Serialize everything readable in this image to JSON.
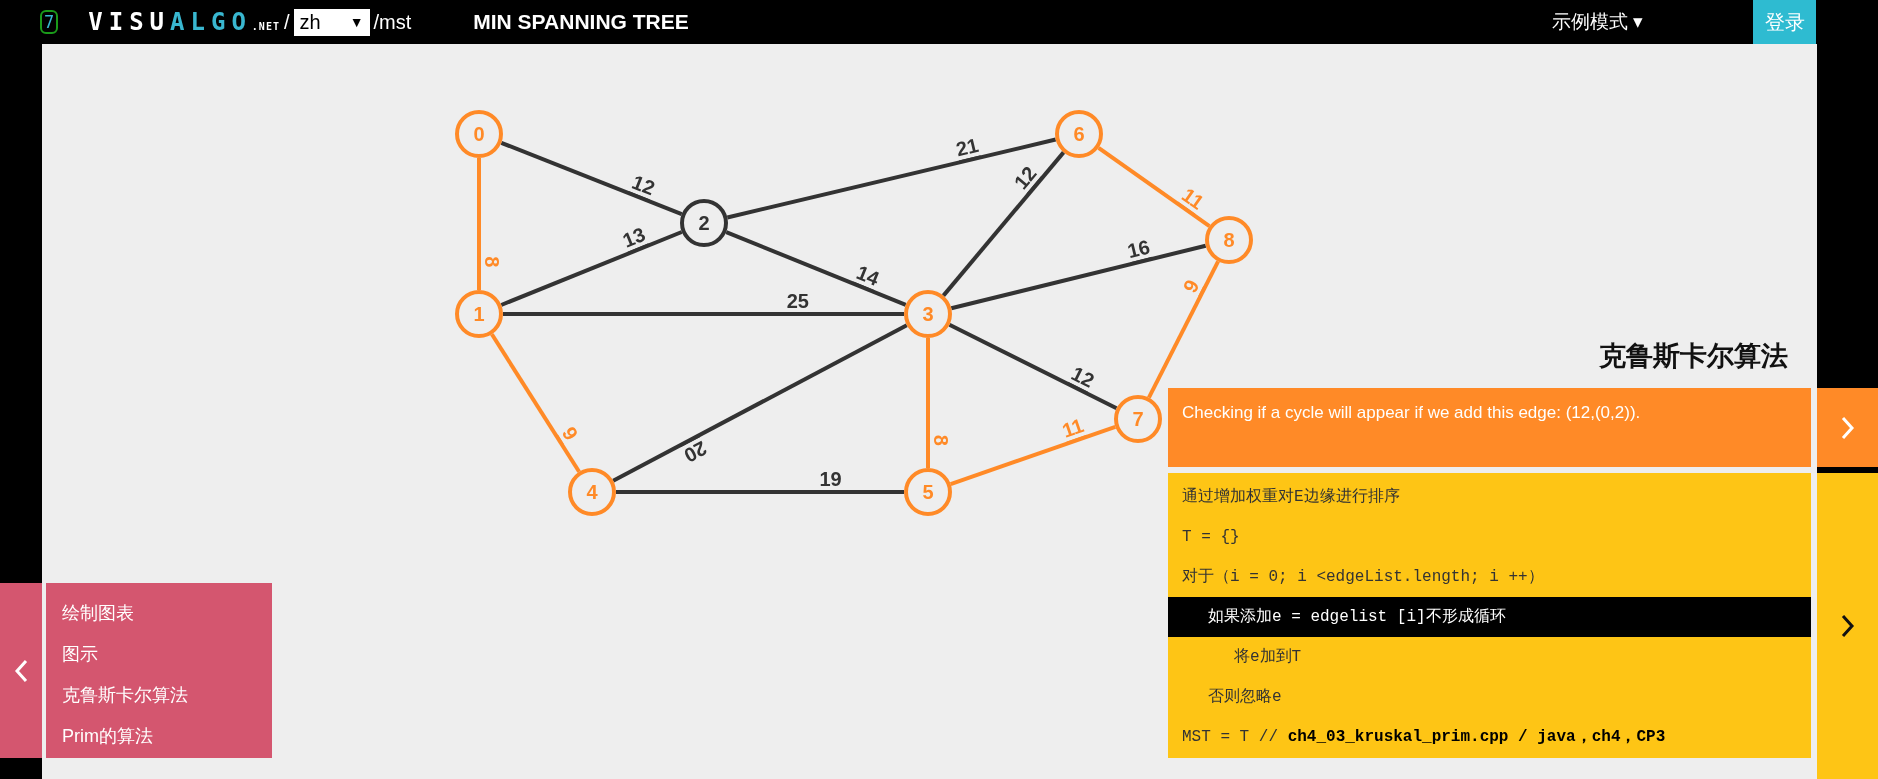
{
  "header": {
    "badge": "7",
    "logo": {
      "text_1": "VISU",
      "text_2": "ALGO",
      "suffix": ".NET"
    },
    "separator": "/",
    "language": {
      "value": "zh",
      "arrow": "▼"
    },
    "path": "/mst",
    "title": "MIN SPANNING TREE",
    "mode_menu": {
      "label": "示例模式",
      "caret": "▾"
    },
    "login": "登录"
  },
  "graph": {
    "nodes": [
      {
        "label": "0",
        "highlighted": true
      },
      {
        "label": "1",
        "highlighted": true
      },
      {
        "label": "2",
        "highlighted": false
      },
      {
        "label": "3",
        "highlighted": true
      },
      {
        "label": "4",
        "highlighted": true
      },
      {
        "label": "5",
        "highlighted": true
      },
      {
        "label": "6",
        "highlighted": true
      },
      {
        "label": "7",
        "highlighted": true
      },
      {
        "label": "8",
        "highlighted": true
      }
    ],
    "edges": [
      {
        "weight": "12",
        "highlighted": false
      },
      {
        "weight": "8",
        "highlighted": true
      },
      {
        "weight": "21",
        "highlighted": false
      },
      {
        "weight": "13",
        "highlighted": false
      },
      {
        "weight": "14",
        "highlighted": false
      },
      {
        "weight": "12",
        "highlighted": false
      },
      {
        "weight": "11",
        "highlighted": true
      },
      {
        "weight": "16",
        "highlighted": false
      },
      {
        "weight": "25",
        "highlighted": false
      },
      {
        "weight": "9",
        "highlighted": true
      },
      {
        "weight": "12",
        "highlighted": false
      },
      {
        "weight": "9",
        "highlighted": true
      },
      {
        "weight": "20",
        "highlighted": false
      },
      {
        "weight": "8",
        "highlighted": true
      },
      {
        "weight": "11",
        "highlighted": true
      },
      {
        "weight": "19",
        "highlighted": false
      }
    ]
  },
  "algorithm_title": "克鲁斯卡尔算法",
  "status": "Checking if a cycle will appear if we add this edge: (12,(0,2)).",
  "code": [
    {
      "text": "通过增加权重对E边缘进行排序",
      "highlighted": false
    },
    {
      "text": "T = {}",
      "highlighted": false
    },
    {
      "text": "对于（i = 0; i <edgeList.length; i ++）",
      "highlighted": false,
      "children": [
        {
          "text": "如果添加e = edgelist [i]不形成循环",
          "highlighted": true,
          "children": [
            {
              "text": "将e加到T",
              "highlighted": false
            }
          ]
        },
        {
          "text": "否则忽略e",
          "highlighted": false
        }
      ]
    },
    {
      "text": "MST = T // **ch4_03_kruskal_prim.cpp / java，ch4，CP3**",
      "highlighted": false
    }
  ],
  "menu": {
    "items": [
      "绘制图表",
      "图示",
      "克鲁斯卡尔算法",
      "Prim的算法"
    ]
  }
}
